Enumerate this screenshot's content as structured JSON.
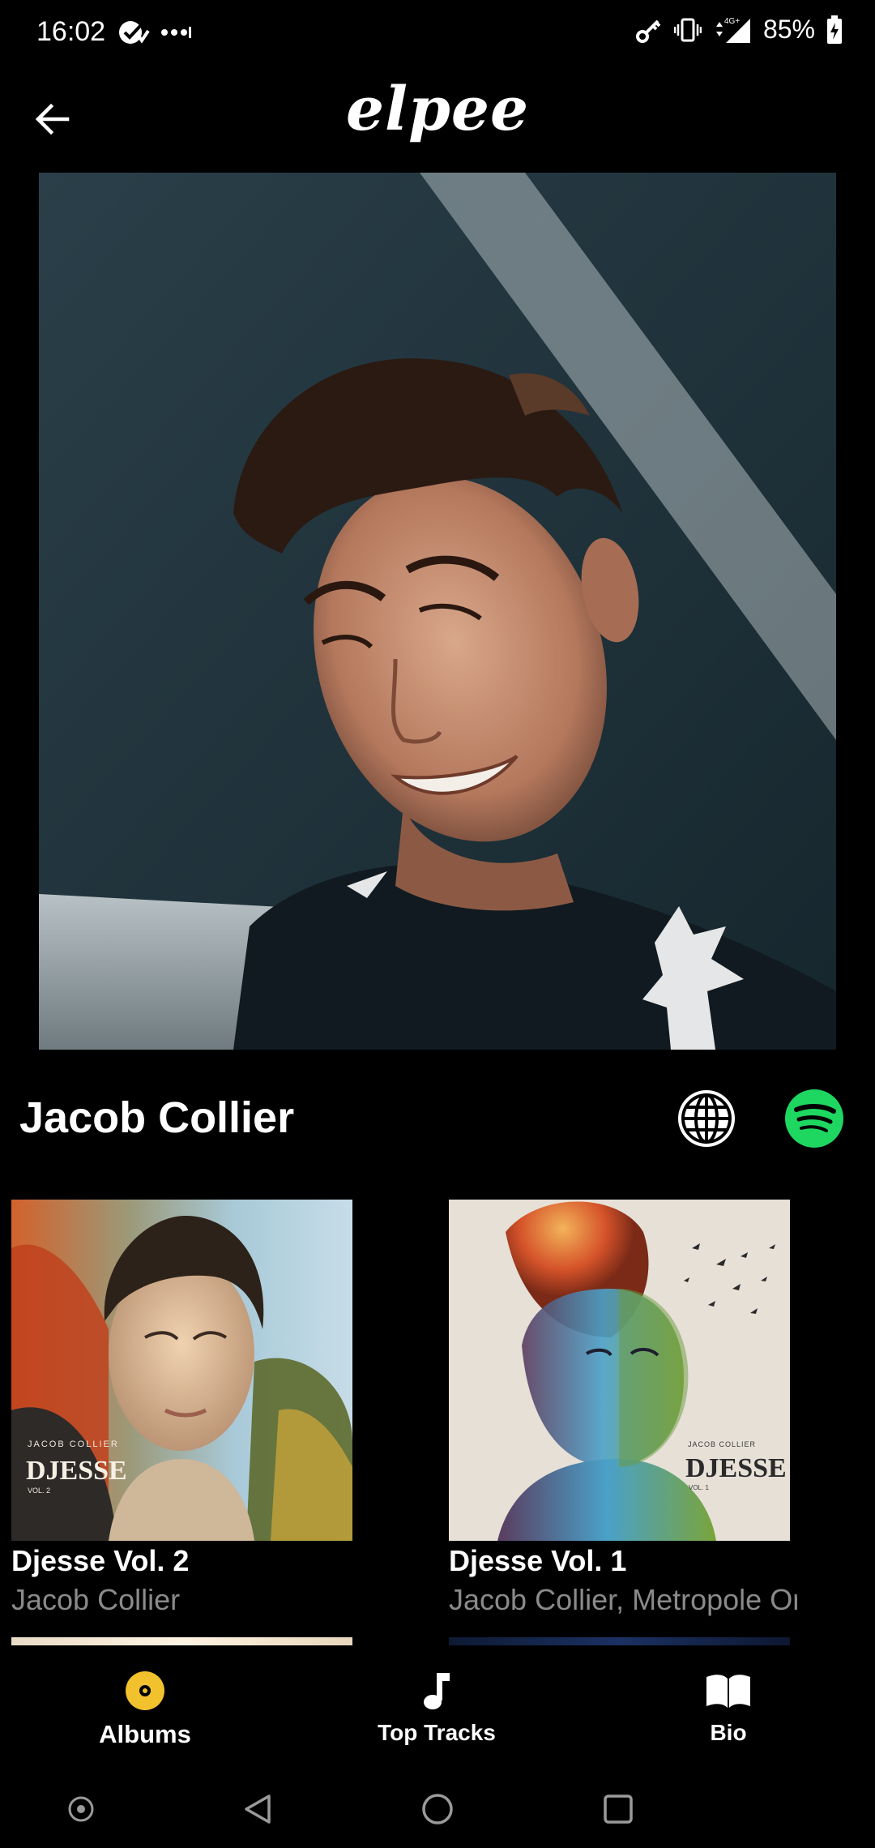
{
  "status_bar": {
    "time": "16:02",
    "network": "4G+",
    "battery": "85%"
  },
  "app_bar": {
    "logo_text": "elpee",
    "back_icon": "arrow-back-icon"
  },
  "artist": {
    "name": "Jacob Collier",
    "photo_icon": "artist-photo",
    "website_icon": "globe-icon",
    "spotify_icon": "spotify-icon"
  },
  "albums": [
    {
      "title": "Djesse Vol. 2",
      "artist": "Jacob Collier",
      "cover_text": "DJESSE",
      "cover_artist": "JACOB COLLIER",
      "cover_volume": "VOL. 2"
    },
    {
      "title": "Djesse Vol. 1",
      "artist": "Jacob Collier, Metropole Orkest",
      "cover_text": "DJESSE",
      "cover_artist": "JACOB COLLIER",
      "cover_volume": "VOL. 1"
    }
  ],
  "bottom_nav": {
    "items": [
      {
        "label": "Albums",
        "icon": "album-icon",
        "active": true
      },
      {
        "label": "Top Tracks",
        "icon": "music-note-icon",
        "active": false
      },
      {
        "label": "Bio",
        "icon": "book-icon",
        "active": false
      }
    ]
  },
  "colors": {
    "background": "#000000",
    "accent_active": "#f2c12e",
    "spotify_green": "#1ed760",
    "muted_text": "#8a8a8a"
  }
}
